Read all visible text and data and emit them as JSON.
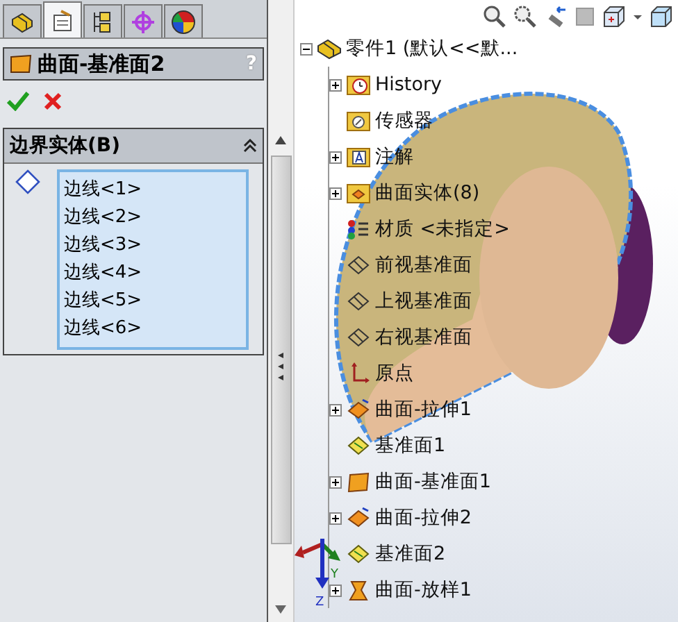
{
  "panel_tabs": [
    {
      "kind": "feature",
      "selected": false
    },
    {
      "kind": "property",
      "selected": true
    },
    {
      "kind": "config",
      "selected": false
    },
    {
      "kind": "dimxpert",
      "selected": false
    },
    {
      "kind": "appearance",
      "selected": false
    }
  ],
  "property_manager": {
    "title": "曲面-基准面2",
    "help": "?",
    "section": {
      "title": "边界实体(B)",
      "expanded": true,
      "items": [
        "边线<1>",
        "边线<2>",
        "边线<3>",
        "边线<4>",
        "边线<5>",
        "边线<6>"
      ]
    }
  },
  "tree": {
    "label": "零件1  (默认<<默...",
    "kind": "part",
    "expanded": true,
    "children": [
      {
        "label": "History",
        "kind": "history",
        "expanded": false
      },
      {
        "label": "传感器",
        "kind": "sensor"
      },
      {
        "label": "注解",
        "kind": "annotation",
        "expanded": false
      },
      {
        "label": "曲面实体(8)",
        "kind": "bodies",
        "expanded": false
      },
      {
        "label": "材质 <未指定>",
        "kind": "material"
      },
      {
        "label": "前视基准面",
        "kind": "plane"
      },
      {
        "label": "上视基准面",
        "kind": "plane"
      },
      {
        "label": "右视基准面",
        "kind": "plane"
      },
      {
        "label": "原点",
        "kind": "origin"
      },
      {
        "label": "曲面-拉伸1",
        "kind": "extrude",
        "expanded": false
      },
      {
        "label": "基准面1",
        "kind": "refplane"
      },
      {
        "label": "曲面-基准面1",
        "kind": "surfplane",
        "expanded": false
      },
      {
        "label": "曲面-拉伸2",
        "kind": "extrude",
        "expanded": false
      },
      {
        "label": "基准面2",
        "kind": "refplane"
      },
      {
        "label": "曲面-放样1",
        "kind": "loft",
        "expanded": false
      }
    ]
  },
  "triad": {
    "labels": [
      "Y",
      "Z"
    ]
  }
}
